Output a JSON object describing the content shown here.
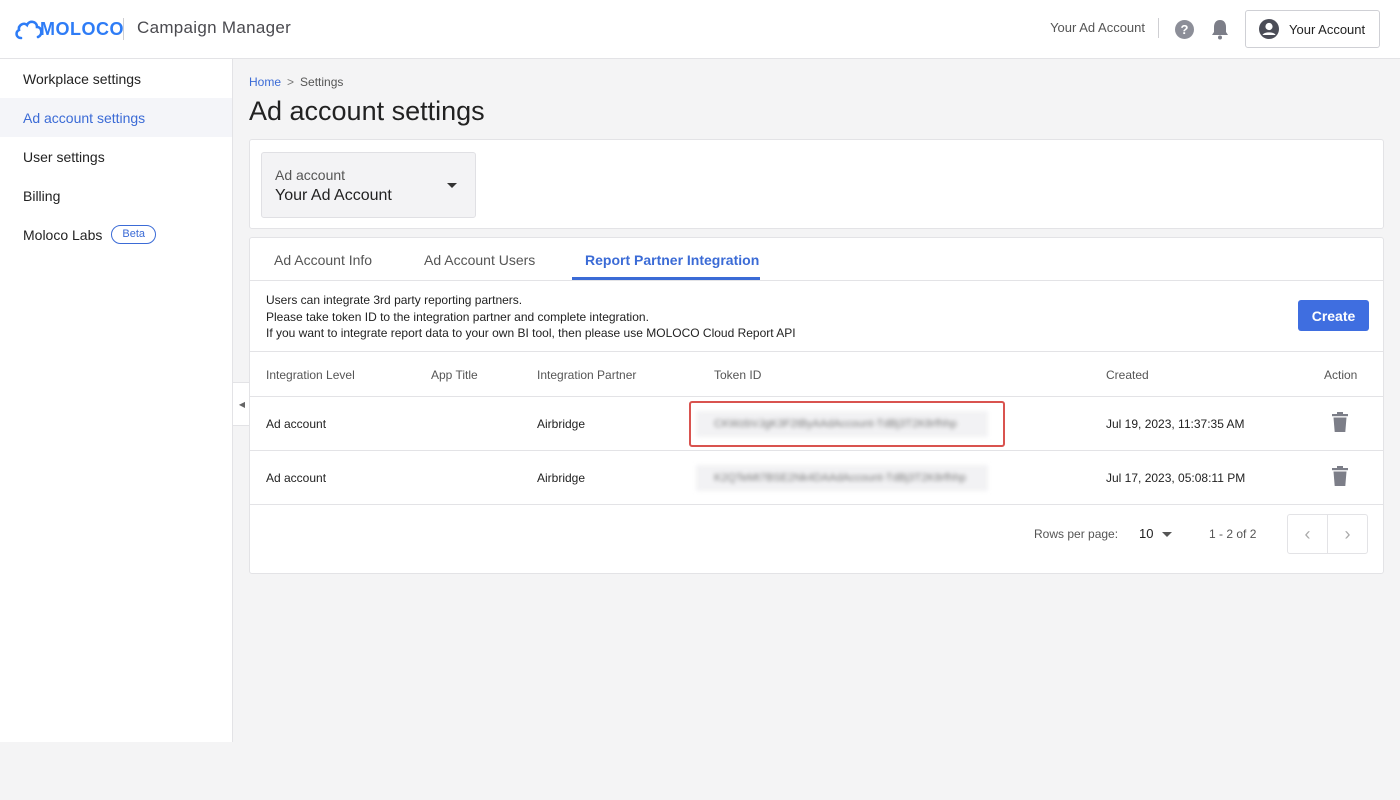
{
  "header": {
    "logo_text": "MOLOCO",
    "app_title": "Campaign Manager",
    "ad_account_name": "Your Ad Account",
    "account_button_label": "Your Account"
  },
  "sidebar": {
    "items": [
      {
        "label": "Workplace settings",
        "active": false
      },
      {
        "label": "Ad account settings",
        "active": true
      },
      {
        "label": "User settings",
        "active": false
      },
      {
        "label": "Billing",
        "active": false
      },
      {
        "label": "Moloco Labs",
        "active": false,
        "badge": "Beta"
      }
    ]
  },
  "breadcrumb": {
    "home": "Home",
    "separator": ">",
    "current": "Settings"
  },
  "page_title": "Ad account settings",
  "ad_account_select": {
    "label": "Ad account",
    "value": "Your Ad Account"
  },
  "tabs": [
    {
      "label": "Ad Account Info",
      "active": false
    },
    {
      "label": "Ad Account Users",
      "active": false
    },
    {
      "label": "Report Partner Integration",
      "active": true
    }
  ],
  "info_lines": [
    "Users can integrate 3rd party reporting partners.",
    "Please take token ID to the integration partner and complete integration.",
    "If you want to integrate report data to your own BI tool, then please use MOLOCO Cloud Report API"
  ],
  "create_button": "Create",
  "table": {
    "columns": [
      "Integration Level",
      "App Title",
      "Integration Partner",
      "Token ID",
      "Created",
      "Action"
    ],
    "rows": [
      {
        "level": "Ad account",
        "app_title": "",
        "partner": "Airbridge",
        "token": "CKWzbVJgK3F2tByAAdAccount-TdBj3T2K8rfhhp",
        "created": "Jul 19, 2023, 11:37:35 AM"
      },
      {
        "level": "Ad account",
        "app_title": "",
        "partner": "Airbridge",
        "token": "K2QTeMt7BSE2Nk4DAAdAccount-TdBj3T2K8rfhhp",
        "created": "Jul 17, 2023, 05:08:11 PM"
      }
    ]
  },
  "pagination": {
    "rows_per_page_label": "Rows per page:",
    "rows_per_page": "10",
    "range": "1 - 2 of 2"
  },
  "colors": {
    "accent": "#3b6bd6",
    "primary_button": "#3f6ee0",
    "highlight_border": "#d9534f"
  }
}
